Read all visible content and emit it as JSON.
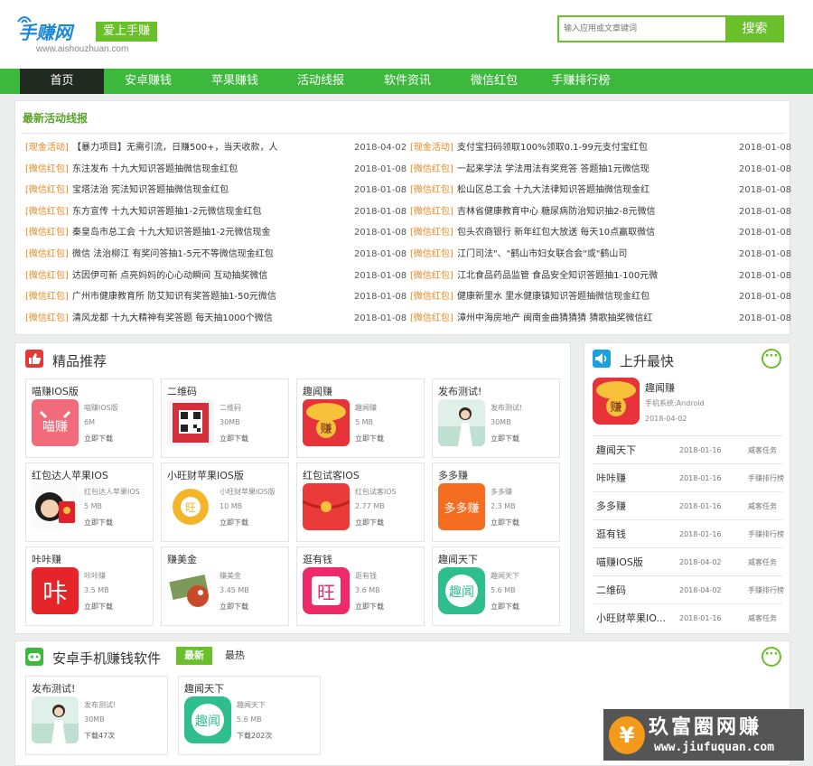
{
  "header": {
    "logo_main": "手赚网",
    "logo_slogan": "爱上手赚",
    "logo_url": "www.aishouzhuan.com",
    "search_placeholder": "输入应用或文章键词",
    "search_button": "搜索"
  },
  "nav": {
    "items": [
      "首页",
      "安卓赚钱",
      "苹果赚钱",
      "活动线报",
      "软件资讯",
      "微信红包",
      "手赚排行榜"
    ],
    "active": "首页"
  },
  "news": {
    "title": "最新活动线报",
    "left": [
      {
        "tag": "[现金活动]",
        "text": "【暴力项目】无需引流，日赚500+，当天收款，人",
        "date": "2018-04-02"
      },
      {
        "tag": "[微信红包]",
        "text": "东注发布 十九大知识答题抽微信现金红包",
        "date": "2018-01-08"
      },
      {
        "tag": "[微信红包]",
        "text": "宝塔法治 宪法知识答题抽微信现金红包",
        "date": "2018-01-08"
      },
      {
        "tag": "[微信红包]",
        "text": "东方宣传 十九大知识答题抽1-2元微信现金红包",
        "date": "2018-01-08"
      },
      {
        "tag": "[微信红包]",
        "text": "秦皇岛市总工会 十九大知识答题抽1-2元微信现金",
        "date": "2018-01-08"
      },
      {
        "tag": "[微信红包]",
        "text": "微信 法治柳江 有奖问答抽1-5元不等微信现金红包",
        "date": "2018-01-08"
      },
      {
        "tag": "[微信红包]",
        "text": "达因伊可新 点亮妈妈的心心动瞬间 互动抽奖微信",
        "date": "2018-01-08"
      },
      {
        "tag": "[微信红包]",
        "text": "广州市健康教育所 防艾知识有奖答题抽1-50元微信",
        "date": "2018-01-08"
      },
      {
        "tag": "[微信红包]",
        "text": "清风龙都 十九大精神有奖答题 每天抽1000个微信",
        "date": "2018-01-08"
      }
    ],
    "right": [
      {
        "tag": "[现金活动]",
        "text": "支付宝扫码领取100%领取0.1-99元支付宝红包",
        "date": "2018-01-08"
      },
      {
        "tag": "[微信红包]",
        "text": "一起来学法 学法用法有奖竞答 答题抽1元微信现",
        "date": "2018-01-08"
      },
      {
        "tag": "[微信红包]",
        "text": "松山区总工会 十九大法律知识答题抽微信现金红",
        "date": "2018-01-08"
      },
      {
        "tag": "[微信红包]",
        "text": "吉林省健康教育中心 糖尿病防治知识抽2-8元微信",
        "date": "2018-01-08"
      },
      {
        "tag": "[微信红包]",
        "text": "包头农商银行 新年红包大放送 每天10点赢取微信",
        "date": "2018-01-08"
      },
      {
        "tag": "[微信红包]",
        "text": "江门司法\"、\"鹤山市妇女联合会\"或\"鹤山司",
        "date": "2018-01-08"
      },
      {
        "tag": "[微信红包]",
        "text": "江北食品药品监管 食品安全知识答题抽1-100元微",
        "date": "2018-01-08"
      },
      {
        "tag": "[微信红包]",
        "text": "健康新里水 里水健康镇知识答题抽微信现金红包",
        "date": "2018-01-08"
      },
      {
        "tag": "[微信红包]",
        "text": "漳州中海房地产 闽南金曲猜猜猜 猜歌抽奖微信红",
        "date": "2018-01-08"
      }
    ]
  },
  "featured": {
    "title": "精品推荐",
    "items": [
      {
        "title": "喵赚IOS版",
        "name": "喵赚IOS版",
        "size": "6M",
        "download": "立即下载",
        "icon": "miaozhuan-icon"
      },
      {
        "title": "二维码",
        "name": "二维码",
        "size": "30MB",
        "download": "立即下载",
        "icon": "qrcode-icon"
      },
      {
        "title": "趣闻赚",
        "name": "趣闻赚",
        "size": "5 MB",
        "download": "立即下载",
        "icon": "redbag-zhuan-icon"
      },
      {
        "title": "发布测试!",
        "name": "发布测试!",
        "size": "30MB",
        "download": "立即下载",
        "icon": "girl-photo-icon"
      },
      {
        "title": "红包达人苹果IOS",
        "name": "红包达人苹果IOS",
        "size": "5 MB",
        "download": "立即下载",
        "icon": "redpacket-man-icon"
      },
      {
        "title": "小旺财苹果IOS版",
        "name": "小旺财苹果IOS版",
        "size": "10 MB",
        "download": "立即下载",
        "icon": "wangcai-icon"
      },
      {
        "title": "红包试客IOS",
        "name": "红包试客IOS",
        "size": "2.77 MB",
        "download": "立即下载",
        "icon": "redpacket-icon"
      },
      {
        "title": "多多赚",
        "name": "多多赚",
        "size": "2.3 MB",
        "download": "立即下载",
        "icon": "duoduozhuan-icon"
      },
      {
        "title": "咔咔赚",
        "name": "咔咔赚",
        "size": "3.5 MB",
        "download": "立即下载",
        "icon": "kaka-icon"
      },
      {
        "title": "赚美金",
        "name": "赚美金",
        "size": "3.45 MB",
        "download": "立即下载",
        "icon": "dollar-bird-icon"
      },
      {
        "title": "逛有钱",
        "name": "逛有钱",
        "size": "3.6 MB",
        "download": "立即下载",
        "icon": "wang-icon"
      },
      {
        "title": "趣闻天下",
        "name": "趣闻天下",
        "size": "5.6 MB",
        "download": "立即下载",
        "icon": "quwen-icon"
      }
    ]
  },
  "rising": {
    "title": "上升最快",
    "top": {
      "name": "趣闻赚",
      "system": "手机系统:Android",
      "date": "2018-04-02"
    },
    "rows": [
      {
        "name": "趣闻天下",
        "date": "2018-01-16",
        "category": "威客任务"
      },
      {
        "name": "咔咔赚",
        "date": "2018-01-16",
        "category": "手赚排行榜"
      },
      {
        "name": "多多赚",
        "date": "2018-01-16",
        "category": "威客任务"
      },
      {
        "name": "逛有钱",
        "date": "2018-01-16",
        "category": "手赚排行榜"
      },
      {
        "name": "喵赚IOS版",
        "date": "2018-04-02",
        "category": "威客任务"
      },
      {
        "name": "二维码",
        "date": "2018-04-02",
        "category": "手赚排行榜"
      },
      {
        "name": "小旺财苹果IO...",
        "date": "2018-01-16",
        "category": "威客任务"
      }
    ]
  },
  "android": {
    "title": "安卓手机赚钱软件",
    "tabs": [
      "最新",
      "最热"
    ],
    "items": [
      {
        "title": "发布测试!",
        "name": "发布测试!",
        "size": "30MB",
        "downloads": "下载47次",
        "icon": "girl-photo-icon"
      },
      {
        "title": "趣闻天下",
        "name": "趣闻天下",
        "size": "5.6 MB",
        "downloads": "下载202次",
        "icon": "quwen-icon"
      }
    ]
  },
  "watermark": {
    "text": "玖富圈网赚",
    "url": "www.jiufuquan.com",
    "coin": "¥"
  },
  "colors": {
    "brand_green": "#69c02b",
    "nav_green": "#3cb93c",
    "tag_orange": "#e8871e",
    "logo_blue": "#1e88d4"
  }
}
